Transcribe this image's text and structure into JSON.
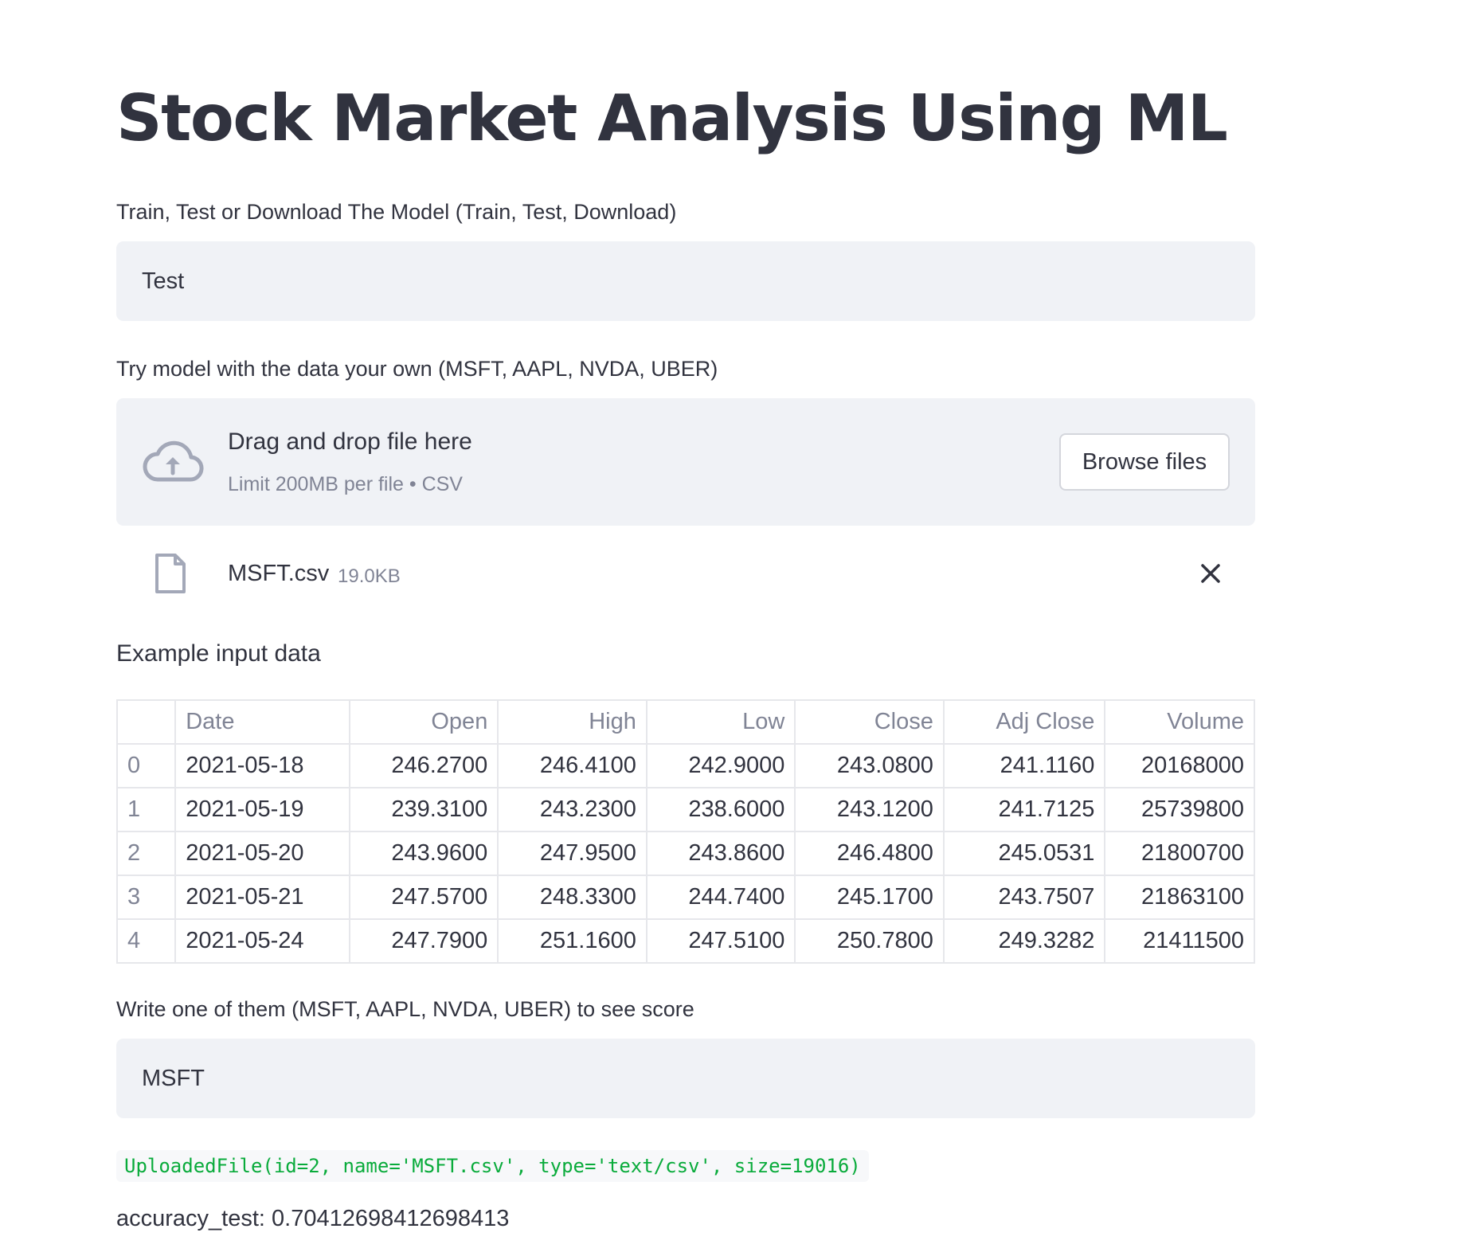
{
  "page": {
    "title": "Stock Market Analysis Using ML"
  },
  "mode_select": {
    "label": "Train, Test or Download The Model (Train, Test, Download)",
    "value": "Test"
  },
  "uploader": {
    "label": "Try model with the data your own (MSFT, AAPL, NVDA, UBER)",
    "drop_text": "Drag and drop file here",
    "limit_text": "Limit 200MB per file • CSV",
    "browse_label": "Browse files",
    "icon": "cloud-upload-icon",
    "file": {
      "name": "MSFT.csv",
      "size": "19.0KB",
      "icon": "file-icon",
      "remove_icon": "close-icon"
    }
  },
  "example": {
    "heading": "Example input data",
    "columns": [
      "",
      "Date",
      "Open",
      "High",
      "Low",
      "Close",
      "Adj Close",
      "Volume"
    ],
    "rows": [
      [
        "0",
        "2021-05-18",
        "246.2700",
        "246.4100",
        "242.9000",
        "243.0800",
        "241.1160",
        "20168000"
      ],
      [
        "1",
        "2021-05-19",
        "239.3100",
        "243.2300",
        "238.6000",
        "243.1200",
        "241.7125",
        "25739800"
      ],
      [
        "2",
        "2021-05-20",
        "243.9600",
        "247.9500",
        "243.8600",
        "246.4800",
        "245.0531",
        "21800700"
      ],
      [
        "3",
        "2021-05-21",
        "247.5700",
        "248.3300",
        "244.7400",
        "245.1700",
        "243.7507",
        "21863100"
      ],
      [
        "4",
        "2021-05-24",
        "247.7900",
        "251.1600",
        "247.5100",
        "250.7800",
        "249.3282",
        "21411500"
      ]
    ]
  },
  "ticker_input": {
    "label": "Write one of them (MSFT, AAPL, NVDA, UBER) to see score",
    "value": "MSFT"
  },
  "output": {
    "code_text": "UploadedFile(id=2, name='MSFT.csv', type='text/csv', size=19016)",
    "accuracy_text": "accuracy_test: 0.70412698412698413"
  },
  "colors": {
    "text": "#31333f",
    "muted": "#808495",
    "widget_bg": "#f0f2f6",
    "code_green": "#09ab3b",
    "border": "#e6e7eb"
  }
}
